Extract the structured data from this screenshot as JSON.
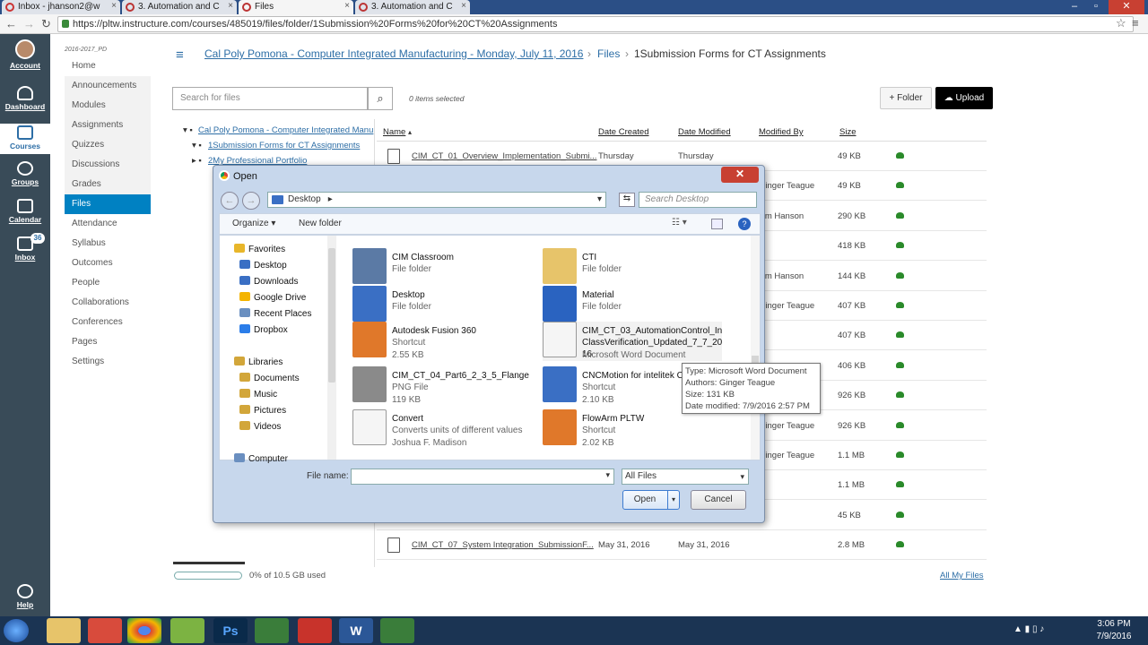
{
  "browser": {
    "tabs": [
      "Inbox - jhanson2@w",
      "3. Automation and C",
      "Files",
      "3. Automation and C"
    ],
    "url": "https://pltw.instructure.com/courses/485019/files/folder/1Submission%20Forms%20for%20CT%20Assignments"
  },
  "global_nav": {
    "items": [
      "Account",
      "Dashboard",
      "Courses",
      "Groups",
      "Calendar",
      "Inbox",
      "Help"
    ],
    "inbox_count": "36"
  },
  "course_nav": {
    "term": "2016-2017_PD",
    "items": [
      "Home",
      "Announcements",
      "Modules",
      "Assignments",
      "Quizzes",
      "Discussions",
      "Grades",
      "Files",
      "Attendance",
      "Syllabus",
      "Outcomes",
      "People",
      "Collaborations",
      "Conferences",
      "Pages",
      "Settings"
    ]
  },
  "breadcrumb": {
    "course": "Cal Poly Pomona - Computer Integrated Manufacturing - Monday, July 11, 2016",
    "files": "Files",
    "folder": "1Submission Forms for CT Assignments"
  },
  "files_toolbar": {
    "search_placeholder": "Search for files",
    "selected": "0 items selected",
    "folder_btn": "Folder",
    "upload_btn": "Upload"
  },
  "folder_tree": [
    "Cal Poly Pomona - Computer Integrated Manu",
    "1Submission Forms for CT Assignments",
    "2My Professional Portfolio"
  ],
  "table": {
    "headers": [
      "Name",
      "Date Created",
      "Date Modified",
      "Modified By",
      "Size"
    ],
    "rows": [
      {
        "name": "CIM_CT_01_Overview_Implementation_Submi...",
        "created": "Thursday",
        "modified": "Thursday",
        "by": "",
        "size": "49 KB"
      },
      {
        "name": "",
        "created": "",
        "modified": "",
        "by": "Ginger Teague",
        "size": "49 KB"
      },
      {
        "name": "",
        "created": "",
        "modified": "",
        "by": "Jim Hanson",
        "size": "290 KB"
      },
      {
        "name": "",
        "created": "",
        "modified": "",
        "by": "",
        "size": "418 KB"
      },
      {
        "name": "",
        "created": "",
        "modified": "",
        "by": "Jim Hanson",
        "size": "144 KB"
      },
      {
        "name": "",
        "created": "",
        "modified": "",
        "by": "Ginger Teague",
        "size": "407 KB"
      },
      {
        "name": "",
        "created": "",
        "modified": "",
        "by": "",
        "size": "407 KB"
      },
      {
        "name": "",
        "created": "",
        "modified": "",
        "by": "",
        "size": "406 KB"
      },
      {
        "name": "",
        "created": "",
        "modified": "",
        "by": "",
        "size": "926 KB"
      },
      {
        "name": "",
        "created": "",
        "modified": "",
        "by": "Ginger Teague",
        "size": "926 KB"
      },
      {
        "name": "",
        "created": "",
        "modified": "",
        "by": "Ginger Teague",
        "size": "1.1 MB"
      },
      {
        "name": "",
        "created": "",
        "modified": "",
        "by": "",
        "size": "1.1 MB"
      },
      {
        "name": "",
        "created": "",
        "modified": "",
        "by": "",
        "size": "45 KB"
      },
      {
        "name": "CIM_CT_07_System Integration_SubmissionF...",
        "created": "May 31, 2016",
        "modified": "May 31, 2016",
        "by": "",
        "size": "2.8 MB"
      }
    ]
  },
  "storage": {
    "used_fraction": 0,
    "text": "0% of 10.5 GB used",
    "all_files": "All My Files"
  },
  "dialog": {
    "title": "Open",
    "path": "Desktop",
    "search_placeholder": "Search Desktop",
    "organize": "Organize",
    "new_folder": "New folder",
    "nav": [
      "Favorites",
      "Desktop",
      "Downloads",
      "Google Drive",
      "Recent Places",
      "Dropbox",
      "Libraries",
      "Documents",
      "Music",
      "Pictures",
      "Videos",
      "Computer"
    ],
    "files": [
      {
        "name": "CIM Classroom",
        "type": "File folder",
        "extra": ""
      },
      {
        "name": "CTI",
        "type": "File folder",
        "extra": ""
      },
      {
        "name": "Desktop",
        "type": "File folder",
        "extra": ""
      },
      {
        "name": "Material",
        "type": "File folder",
        "extra": ""
      },
      {
        "name": "Autodesk Fusion 360",
        "type": "Shortcut",
        "extra": "2.55 KB"
      },
      {
        "name": "CIM_CT_03_AutomationControl_InClassVerification_Updated_7_7_2016",
        "type": "Microsoft Word Document",
        "extra": ""
      },
      {
        "name": "CIM_CT_04_Part6_2_3_5_Flange",
        "type": "PNG File",
        "extra": "119 KB"
      },
      {
        "name": "CNCMotion for intelitek C",
        "type": "Shortcut",
        "extra": "2.10 KB"
      },
      {
        "name": "Convert",
        "type": "Converts units of different values",
        "extra": "Joshua F. Madison"
      },
      {
        "name": "FlowArm PLTW",
        "type": "Shortcut",
        "extra": "2.02 KB"
      }
    ],
    "tooltip": [
      "Type: Microsoft Word Document",
      "Authors: Ginger Teague",
      "Size: 131 KB",
      "Date modified: 7/9/2016 2:57 PM"
    ],
    "filename_label": "File name:",
    "filetype": "All Files",
    "open_btn": "Open",
    "cancel_btn": "Cancel"
  },
  "clock": {
    "time": "3:06 PM",
    "date": "7/9/2016"
  }
}
